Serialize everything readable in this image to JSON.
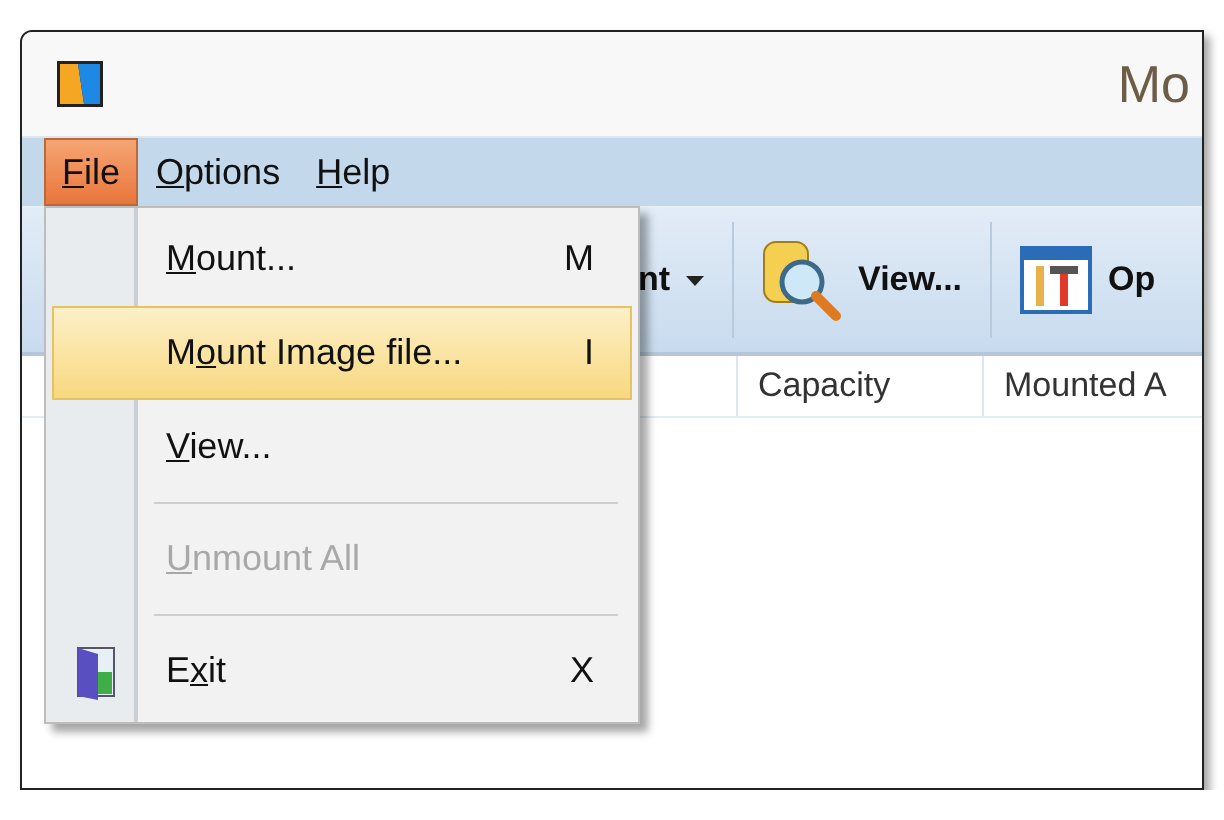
{
  "window": {
    "title": "Mo"
  },
  "menu_bar": [
    {
      "key": "F",
      "after": "ile",
      "selected": true
    },
    {
      "key": "O",
      "after": "ptions",
      "selected": false
    },
    {
      "key": "H",
      "after": "elp",
      "selected": false
    }
  ],
  "toolbar": [
    {
      "kind": "dropdown",
      "label": "nt"
    },
    {
      "kind": "view",
      "label": "View..."
    },
    {
      "kind": "options",
      "label": "Op"
    }
  ],
  "columns": [
    "Capacity",
    "Mounted A"
  ],
  "file_menu": [
    {
      "kind": "item",
      "key": "M",
      "after": "ount...",
      "shortcut": "M",
      "selected": false,
      "disabled": false
    },
    {
      "kind": "item",
      "before": "M",
      "key": "o",
      "after": "unt Image file...",
      "shortcut": "I",
      "selected": true,
      "disabled": false
    },
    {
      "kind": "item",
      "key": "V",
      "after": "iew...",
      "selected": false,
      "disabled": false
    },
    {
      "kind": "separator"
    },
    {
      "kind": "item",
      "key": "U",
      "after": "nmount All",
      "selected": false,
      "disabled": true
    },
    {
      "kind": "separator"
    },
    {
      "kind": "exit",
      "before": "E",
      "key": "x",
      "after": "it",
      "shortcut": "X",
      "selected": false,
      "disabled": false
    }
  ]
}
